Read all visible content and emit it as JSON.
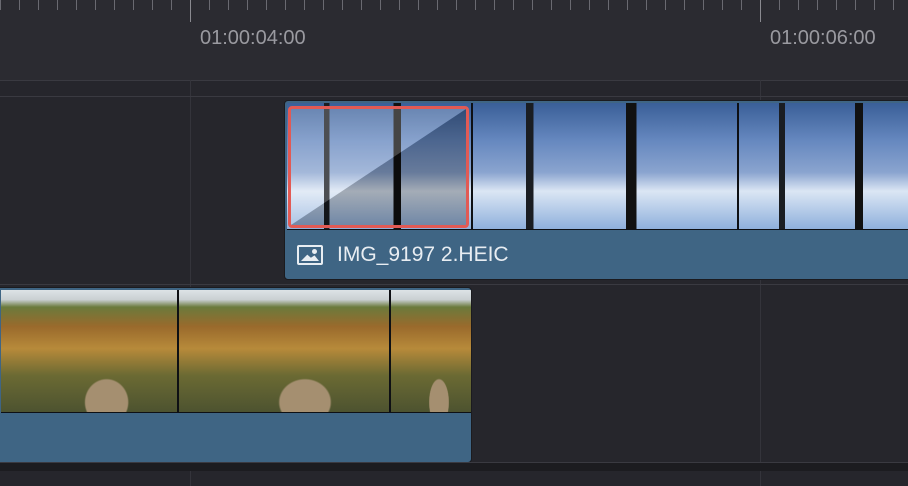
{
  "ruler": {
    "timecode_1": "01:00:04:00",
    "timecode_2": "01:00:06:00"
  },
  "clips": {
    "upper_clip": {
      "name": "IMG_9197 2.HEIC",
      "icon": "image-icon"
    },
    "lower_clip": {
      "name": ""
    }
  },
  "transition": {
    "type": "cross-dissolve"
  },
  "colors": {
    "clip_blue": "#3f6584",
    "transition_red": "#e25a54",
    "background": "#26262c"
  }
}
